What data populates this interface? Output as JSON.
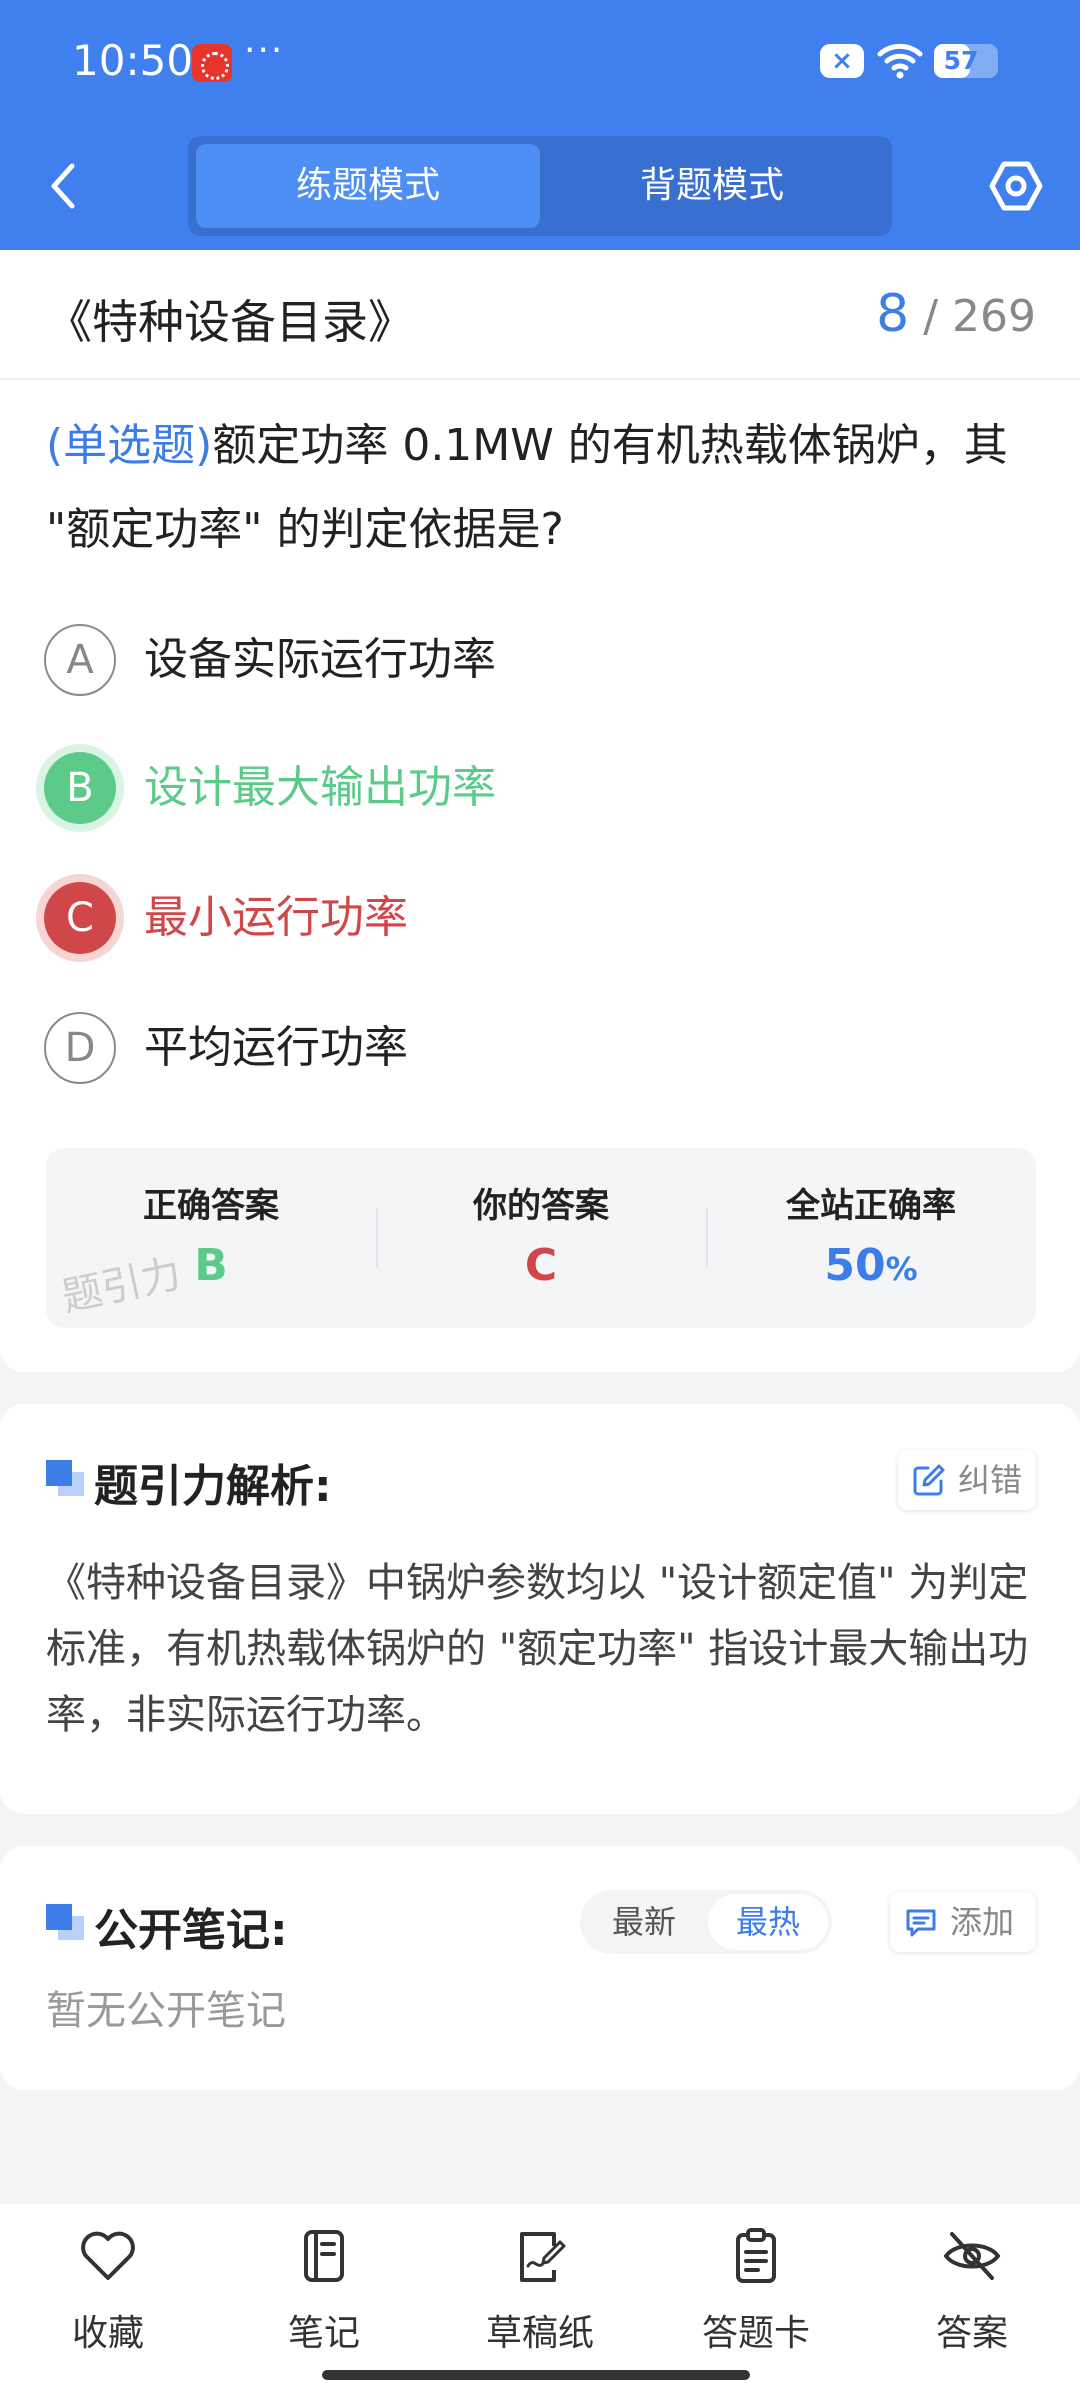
{
  "status_bar": {
    "time": "10:50",
    "dots": "···",
    "battery": "57",
    "battery_level": 0.57
  },
  "header": {
    "modes": [
      "练题模式",
      "背题模式"
    ],
    "active_mode": "练题模式"
  },
  "subject": {
    "title": "《特种设备目录》",
    "current": "8",
    "separator": " / ",
    "total": "269"
  },
  "question": {
    "type": "(单选题)",
    "text": "额定功率 0.1MW 的有机热载体锅炉，其 \"额定功率\" 的判定依据是?",
    "options": [
      {
        "letter": "A",
        "text": "设备实际运行功率",
        "state": "normal"
      },
      {
        "letter": "B",
        "text": "设计最大输出功率",
        "state": "correct"
      },
      {
        "letter": "C",
        "text": "最小运行功率",
        "state": "wrong"
      },
      {
        "letter": "D",
        "text": "平均运行功率",
        "state": "normal"
      }
    ]
  },
  "result": {
    "correct_label": "正确答案",
    "correct_value": "B",
    "yours_label": "你的答案",
    "yours_value": "C",
    "rate_label": "全站正确率",
    "rate_value": "50",
    "rate_unit": "%",
    "watermark": "题引力"
  },
  "analysis": {
    "title": "题引力解析:",
    "report_label": "纠错",
    "text": "《特种设备目录》中锅炉参数均以 \"设计额定值\" 为判定标准，有机热载体锅炉的 \"额定功率\" 指设计最大输出功率，非实际运行功率。"
  },
  "notes": {
    "title": "公开笔记:",
    "sort_latest": "最新",
    "sort_hot": "最热",
    "add_label": "添加",
    "empty": "暂无公开笔记"
  },
  "bottom_nav": [
    "收藏",
    "笔记",
    "草稿纸",
    "答题卡",
    "答案"
  ],
  "colors": {
    "brand": "#4080ee",
    "correct": "#5ccb89",
    "wrong": "#d0474a",
    "accent": "#3d7de8"
  }
}
